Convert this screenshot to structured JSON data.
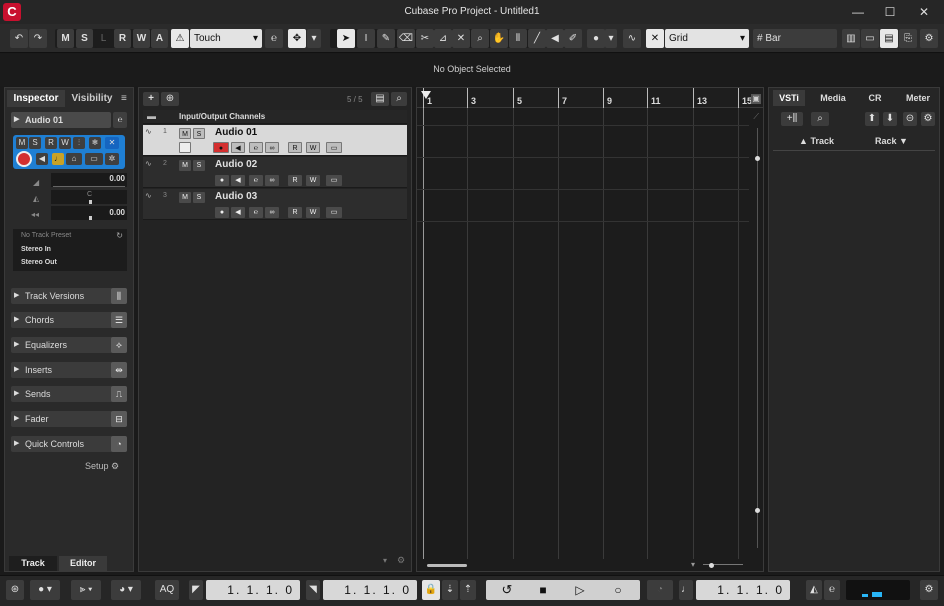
{
  "window": {
    "title": "Cubase Pro Project - Untitled1",
    "minimize": "—",
    "maximize": "☐",
    "close": "✕"
  },
  "toolbar": {
    "undo": "↶",
    "redo": "↷",
    "m": "M",
    "s": "S",
    "l": "L",
    "r": "R",
    "w": "W",
    "a": "A",
    "automation_mode": "Touch",
    "snap_type": "Grid",
    "grid_type": "Bar"
  },
  "info_line": {
    "message": "No Object Selected"
  },
  "inspector": {
    "tab_inspector": "Inspector",
    "tab_visibility": "Visibility",
    "track_name": "Audio 01",
    "volume": "0.00",
    "pan": "C",
    "delay": "0.00",
    "preset": "No Track Preset",
    "input": "Stereo In",
    "output": "Stereo Out",
    "sections": [
      "Track Versions",
      "Chords",
      "Equalizers",
      "Inserts",
      "Sends",
      "Fader",
      "Quick Controls"
    ],
    "setup": "Setup",
    "bottom_tab_track": "Track",
    "bottom_tab_editor": "Editor"
  },
  "tracklist": {
    "counter": "5 / 5",
    "folder": "Input/Output Channels",
    "tracks": [
      {
        "num": "1",
        "name": "Audio 01"
      },
      {
        "num": "2",
        "name": "Audio 02"
      },
      {
        "num": "3",
        "name": "Audio 03"
      }
    ]
  },
  "ruler": {
    "bars": [
      "1",
      "3",
      "5",
      "7",
      "9",
      "11",
      "13",
      "15"
    ]
  },
  "rack": {
    "tabs": [
      "VSTi",
      "Media",
      "CR",
      "Meter"
    ],
    "col_track": "Track",
    "col_rack": "Rack"
  },
  "transport": {
    "aq": "AQ",
    "left_locator": "1. 1. 1.  0",
    "right_locator": "1. 1. 1.  0",
    "position": "1. 1. 1.  0"
  },
  "colors": {
    "record": "#d32f2f",
    "accent": "#c8102e",
    "selected_track": "#d9d9d9"
  }
}
